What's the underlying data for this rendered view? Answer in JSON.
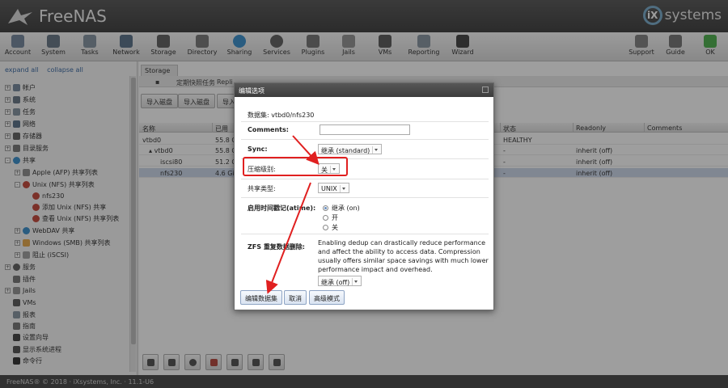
{
  "brand": {
    "name": "FreeNAS",
    "partner": "systems",
    "partner_mark": "iX"
  },
  "toolbar": {
    "left": [
      "Account",
      "System",
      "Tasks",
      "Network",
      "Storage",
      "Directory",
      "Sharing",
      "Services",
      "Plugins",
      "Jails",
      "VMs",
      "Reporting",
      "Wizard"
    ],
    "right": [
      "Support",
      "Guide",
      "OK"
    ]
  },
  "sidebar": {
    "expand_all": "expand all",
    "collapse_all": "collapse all",
    "items": [
      "帐户",
      "系统",
      "任务",
      "网络",
      "存储器",
      "目录服务",
      "共享",
      "Apple (AFP) 共享列表",
      "Unix (NFS) 共享列表",
      "nfs230",
      "添加 Unix (NFS) 共享",
      "查看 Unix (NFS) 共享列表",
      "WebDAV 共享",
      "Windows (SMB) 共享列表",
      "阻止 (iSCSI)",
      "服务",
      "插件",
      "Jails",
      "VMs",
      "报表",
      "指南",
      "设置向导",
      "显示系统进程",
      "命令行"
    ]
  },
  "main": {
    "tab": "Storage",
    "subtabs": [
      "定期快照任务",
      "Repli"
    ],
    "buttons": [
      "导入磁盘",
      "导入磁盘",
      "导入"
    ],
    "columns": [
      "名称",
      "已用",
      "状态",
      "Readonly",
      "Comments"
    ],
    "rows": [
      {
        "name": "vtbd0",
        "used": "55.8 G",
        "status": "HEALTHY",
        "readonly": ""
      },
      {
        "name": "vtbd0",
        "used": "55.8 G",
        "status": "-",
        "readonly": "inherit (off)"
      },
      {
        "name": "iscsi80",
        "used": "51.2 G",
        "status": "-",
        "readonly": "inherit (off)"
      },
      {
        "name": "nfs230",
        "used": "4.6 Gi",
        "status": "-",
        "readonly": "inherit (off)"
      }
    ]
  },
  "footer": {
    "text": "FreeNAS® © 2018 · iXsystems, Inc. · 11.1-U6"
  },
  "modal": {
    "title": "编辑选项",
    "dataset_label": "数据集: vtbd0/nfs230",
    "comments_label": "Comments:",
    "sync_label": "Sync:",
    "sync_value": "继承 (standard)",
    "compression_label": "压缩级别:",
    "compression_value": "关",
    "share_type_label": "共享类型:",
    "share_type_value": "UNIX",
    "atime_label": "启用时间戳记(atime):",
    "atime_options": [
      "继承 (on)",
      "开",
      "关"
    ],
    "dedup_label": "ZFS 重复数据删除:",
    "dedup_hint": "Enabling dedup can drastically reduce performance and affect the ability to access data. Compression usually offers similar space savings with much lower performance impact and overhead.",
    "dedup_value": "继承 (off)",
    "buttons": [
      "编辑数据集",
      "取消",
      "高级模式"
    ]
  },
  "colors": {
    "highlight": "#e02020",
    "header_bg": "#3a3a3a",
    "selection": "#c9d5ea"
  }
}
